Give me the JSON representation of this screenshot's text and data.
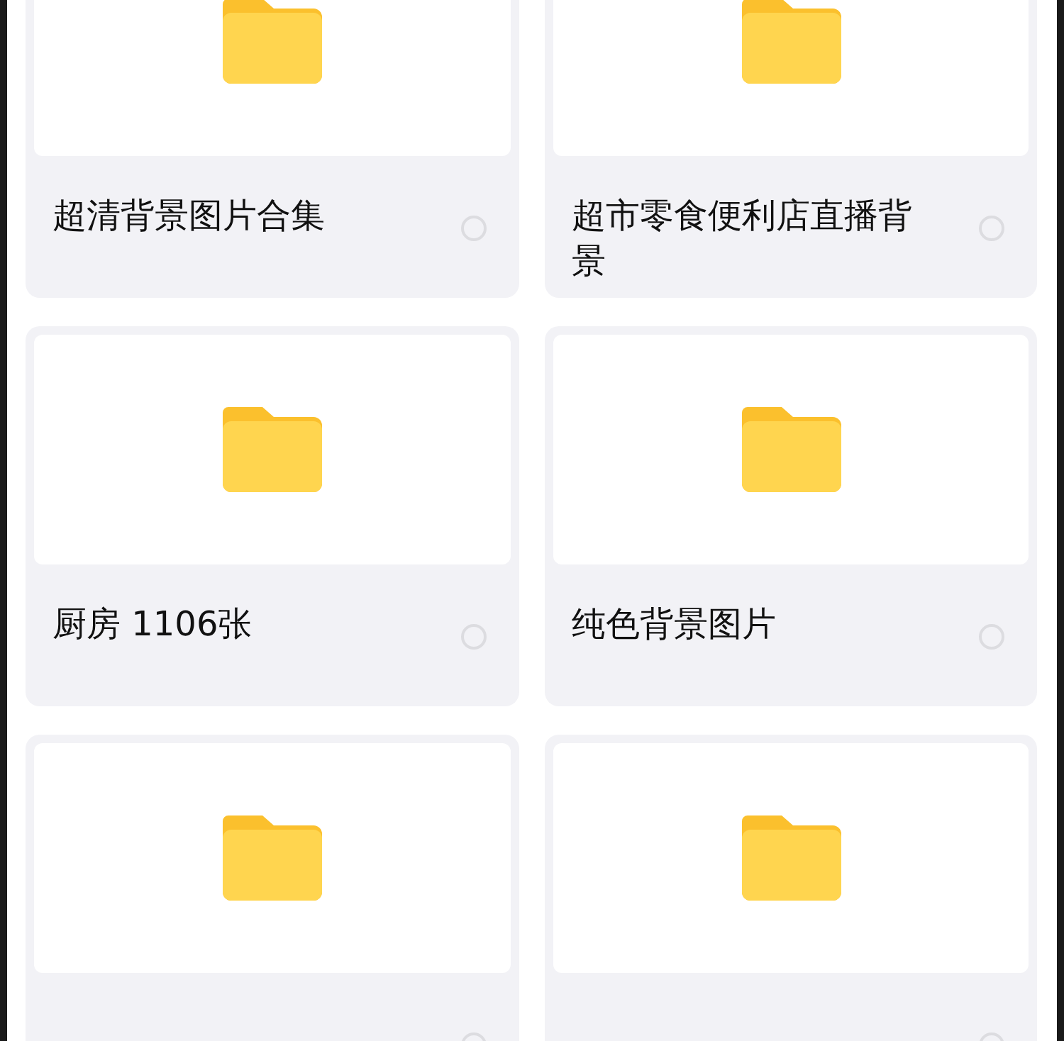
{
  "folders": [
    {
      "name": "超清背景图片合集",
      "selected": false
    },
    {
      "name": "超市零食便利店直播背景",
      "selected": false
    },
    {
      "name": "厨房 1106张",
      "selected": false
    },
    {
      "name": "纯色背景图片",
      "selected": false
    },
    {
      "selected": false
    },
    {
      "selected": false
    }
  ]
}
